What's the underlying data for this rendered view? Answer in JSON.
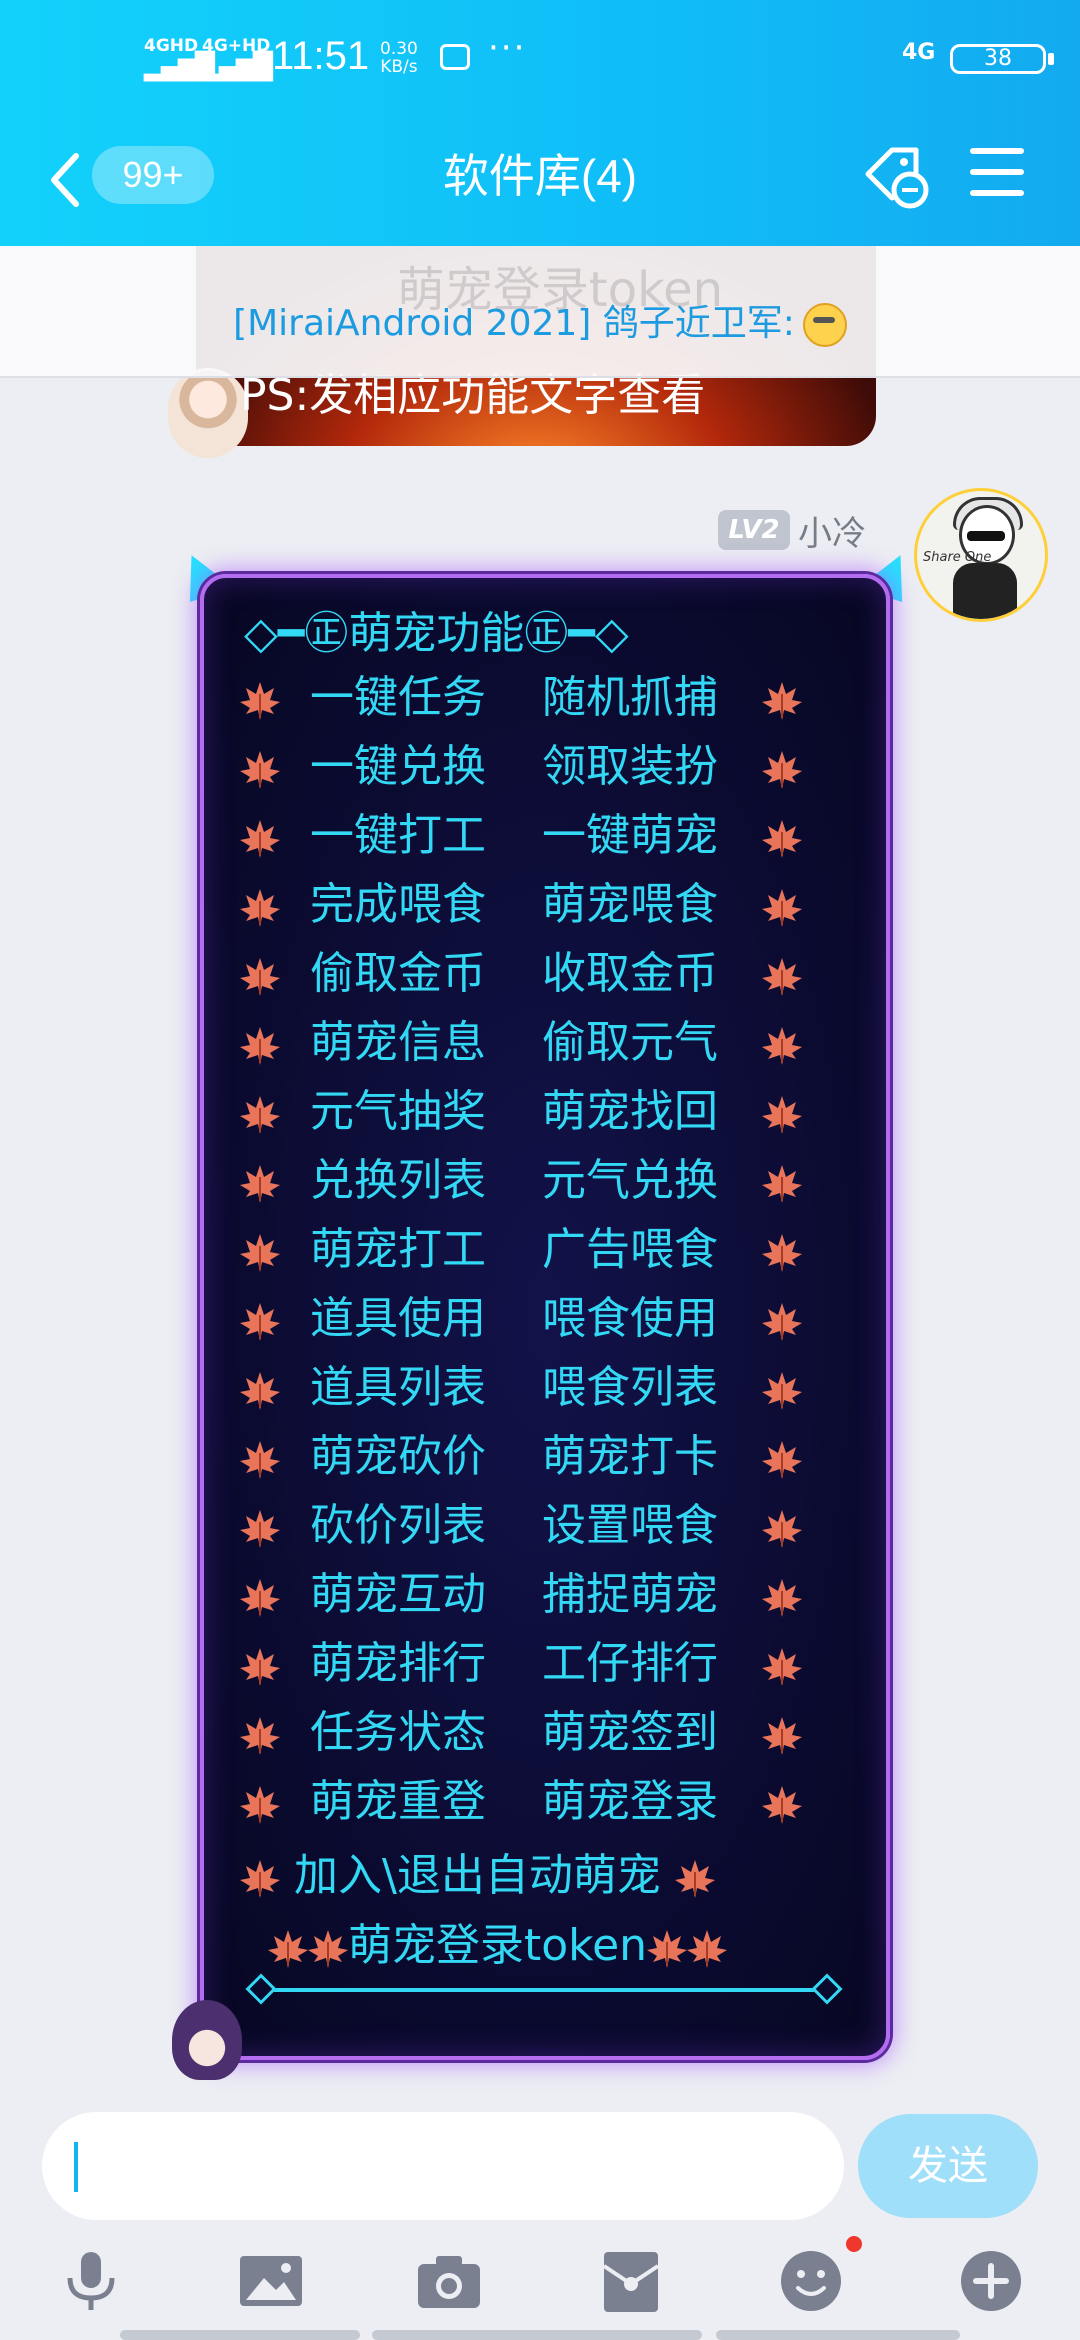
{
  "status_bar": {
    "signal1": "4GHD",
    "signal2": "4G+HD",
    "time": "11:51",
    "speed_value": "0.30",
    "speed_unit": "KB/s",
    "more": "···",
    "network": "4G",
    "battery": "38"
  },
  "nav": {
    "unread_badge": "99+",
    "title": "软件库(4)"
  },
  "notice": {
    "ghost_text": "萌宠登录token",
    "text": "[MiraiAndroid 2021] 鸽子近卫军:"
  },
  "previous_message": {
    "text": "PS:发相应功能文字查看"
  },
  "sender": {
    "level": "LV2",
    "name": "小冷",
    "avatar_caption": "Share One"
  },
  "bubble": {
    "header": "◇━㊣萌宠功能㊣━◇",
    "rows": [
      [
        "一键任务",
        "随机抓捕"
      ],
      [
        "一键兑换",
        "领取装扮"
      ],
      [
        "一键打工",
        "一键萌宠"
      ],
      [
        "完成喂食",
        "萌宠喂食"
      ],
      [
        "偷取金币",
        "收取金币"
      ],
      [
        "萌宠信息",
        "偷取元气"
      ],
      [
        "元气抽奖",
        "萌宠找回"
      ],
      [
        "兑换列表",
        "元气兑换"
      ],
      [
        "萌宠打工",
        "广告喂食"
      ],
      [
        "道具使用",
        "喂食使用"
      ],
      [
        "道具列表",
        "喂食列表"
      ],
      [
        "萌宠砍价",
        "萌宠打卡"
      ],
      [
        "砍价列表",
        "设置喂食"
      ],
      [
        "萌宠互动",
        "捕捉萌宠"
      ],
      [
        "萌宠排行",
        "工仔排行"
      ],
      [
        "任务状态",
        "萌宠签到"
      ],
      [
        "萌宠重登",
        "萌宠登录"
      ]
    ],
    "line_18": "加入\\退出自动萌宠",
    "line_19": "萌宠登录token"
  },
  "input": {
    "value": "",
    "send_label": "发送"
  },
  "colors": {
    "top_bar": "#12c8fa",
    "bubble_text": "#32d8f4",
    "bubble_border": "#b46cf0",
    "send_button": "#9fdff9"
  },
  "icons": [
    "back-chevron-icon",
    "tag-icon",
    "menu-icon",
    "leaf-icon",
    "mic-icon",
    "image-icon",
    "camera-icon",
    "red-packet-icon",
    "emoji-icon",
    "plus-icon"
  ]
}
